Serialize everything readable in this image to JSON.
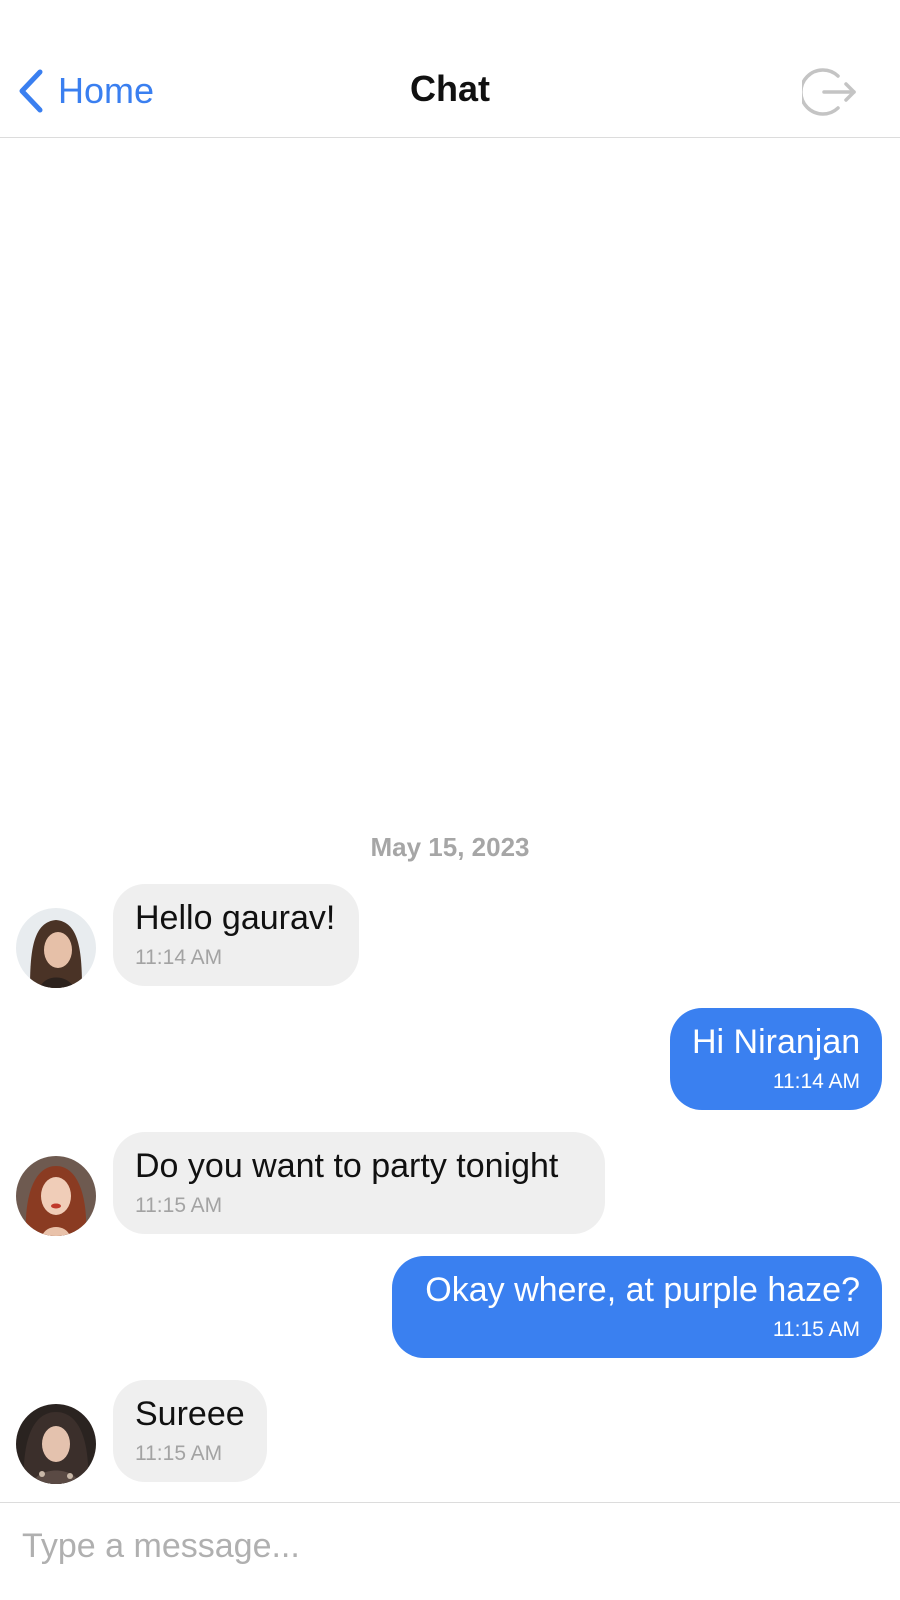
{
  "header": {
    "back_label": "Home",
    "title": "Chat",
    "back_icon": "chevron-left-icon",
    "logout_icon": "logout-icon"
  },
  "date_separator": "May 15, 2023",
  "messages": [
    {
      "direction": "incoming",
      "text": "Hello gaurav!",
      "time": "11:14 AM"
    },
    {
      "direction": "outgoing",
      "text": "Hi Niranjan",
      "time": "11:14 AM"
    },
    {
      "direction": "incoming",
      "text": "Do you want to party tonight",
      "time": "11:15 AM"
    },
    {
      "direction": "outgoing",
      "text": "Okay where, at purple haze?",
      "time": "11:15 AM"
    },
    {
      "direction": "incoming",
      "text": "Sureee",
      "time": "11:15 AM"
    }
  ],
  "composer": {
    "placeholder": "Type a message...",
    "value": ""
  },
  "colors": {
    "accent": "#3a7ff0",
    "outgoing_bubble": "#3a80f0",
    "incoming_bubble": "#efefef",
    "muted_text": "#a6a6a6"
  }
}
